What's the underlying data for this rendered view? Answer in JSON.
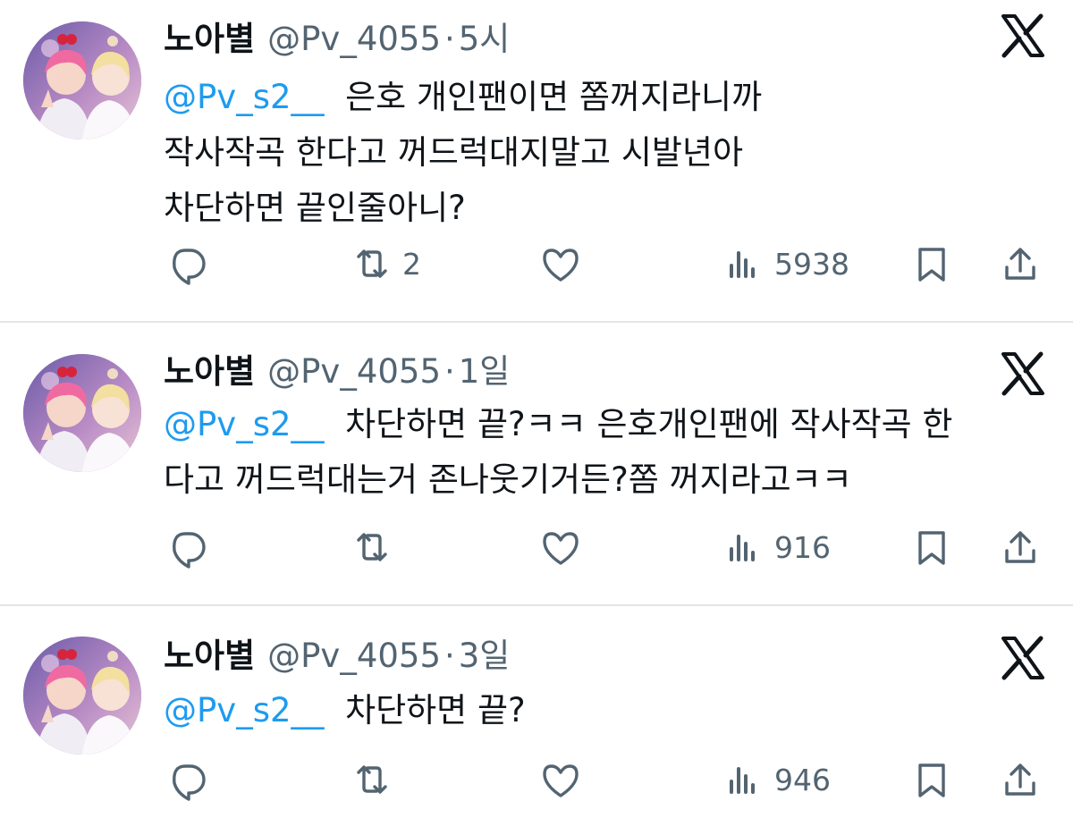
{
  "colors": {
    "accent": "#1d9bf0",
    "muted": "#536471",
    "text": "#0f1419",
    "separator": "#e3e6e9"
  },
  "tweets": [
    {
      "name": "노아별",
      "handle": "@Pv_4055",
      "dot": "·",
      "time": "5시",
      "mention": "@Pv_s2__",
      "text": "은호 개인팬이면 쫌꺼지라니까\n작사작곡 한다고 꺼드럭대지말고 시발년아\n차단하면 끝인줄아니?",
      "retweets": "2",
      "views": "5938",
      "icons": [
        "reply-icon",
        "retweet-icon",
        "like-icon",
        "views-icon",
        "bookmark-icon",
        "share-icon",
        "x-logo-icon"
      ]
    },
    {
      "name": "노아별",
      "handle": "@Pv_4055",
      "dot": "·",
      "time": "1일",
      "mention": "@Pv_s2__",
      "text": "차단하면 끝?ㅋㅋ 은호개인팬에 작사작곡 한\n다고 꺼드럭대는거 존나웃기거든?쫌 꺼지라고ㅋㅋ",
      "retweets": "",
      "views": "916"
    },
    {
      "name": "노아별",
      "handle": "@Pv_4055",
      "dot": "·",
      "time": "3일",
      "mention": "@Pv_s2__",
      "text": "차단하면 끝?",
      "retweets": "",
      "views": "946"
    }
  ]
}
